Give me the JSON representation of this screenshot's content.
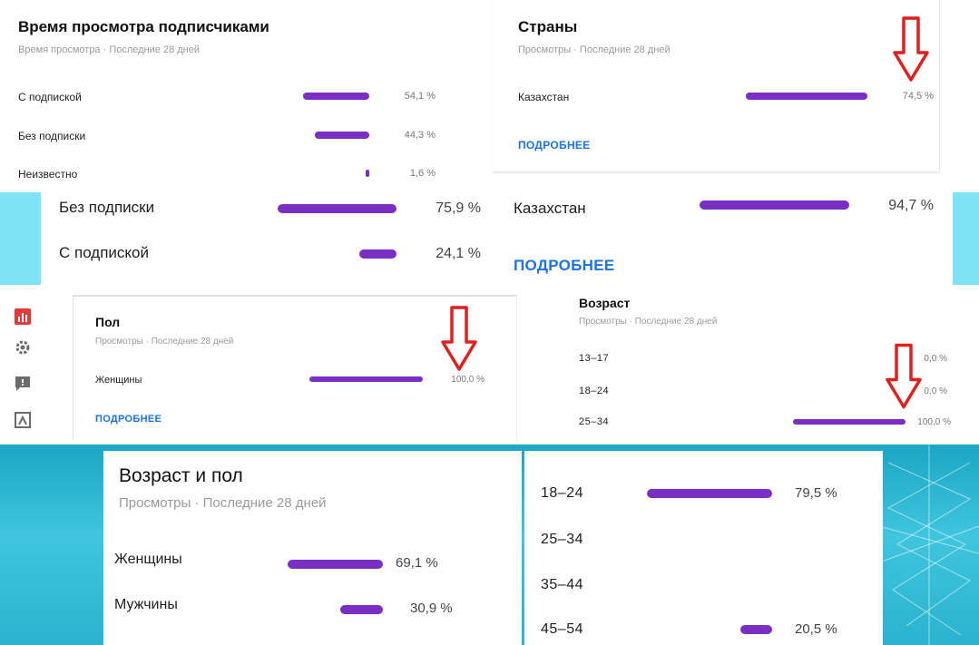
{
  "s1": {
    "title": "Время просмотра подписчиками",
    "subtitle": "Время просмотра · Последние 28 дней",
    "rows": [
      {
        "label": "С подпиской",
        "value": "54,1 %",
        "fraction": 0.541
      },
      {
        "label": "Без подписки",
        "value": "44,3 %",
        "fraction": 0.443
      },
      {
        "label": "Неизвестно",
        "value": "1,6 %",
        "fraction": 0.016
      }
    ]
  },
  "s2": {
    "title": "Страны",
    "subtitle": "Просмотры · Последние 28 дней",
    "rows": [
      {
        "label": "Казахстан",
        "value": "74,5 %",
        "fraction": 0.745
      }
    ],
    "more": "ПОДРОБНЕЕ"
  },
  "s3": {
    "rows": [
      {
        "label": "Без подписки",
        "value": "75,9 %",
        "fraction": 0.759
      },
      {
        "label": "С подпиской",
        "value": "24,1 %",
        "fraction": 0.241
      }
    ]
  },
  "s4": {
    "rows": [
      {
        "label": "Казахстан",
        "value": "94,7 %",
        "fraction": 0.947
      }
    ],
    "more": "ПОДРОБНЕЕ"
  },
  "s5": {
    "title": "Пол",
    "subtitle": "Просмотры · Последние 28 дней",
    "rows": [
      {
        "label": "Женщины",
        "value": "100,0 %",
        "fraction": 1.0
      }
    ],
    "more": "ПОДРОБНЕЕ"
  },
  "s6": {
    "title": "Возраст",
    "subtitle": "Просмотры · Последние 28 дней",
    "rows": [
      {
        "label": "13–17",
        "value": "0,0 %",
        "fraction": 0.0
      },
      {
        "label": "18–24",
        "value": "0,0 %",
        "fraction": 0.0
      },
      {
        "label": "25–34",
        "value": "100,0 %",
        "fraction": 1.0
      }
    ]
  },
  "s7": {
    "title": "Возраст и пол",
    "subtitle": "Просмотры · Последние 28 дней",
    "rows": [
      {
        "label": "Женщины",
        "value": "69,1 %",
        "fraction": 0.691
      },
      {
        "label": "Мужчины",
        "value": "30,9 %",
        "fraction": 0.309
      }
    ]
  },
  "s8": {
    "rows": [
      {
        "label": "18–24",
        "value": "79,5 %",
        "fraction": 0.795
      },
      {
        "label": "25–34",
        "value": "",
        "fraction": 0.0
      },
      {
        "label": "35–44",
        "value": "",
        "fraction": 0.0
      },
      {
        "label": "45–54",
        "value": "20,5 %",
        "fraction": 0.205
      }
    ]
  },
  "colors": {
    "bar": "#7b2ec4",
    "link": "#1a73e8",
    "arrow": "#e0201e",
    "cyan": "#7ee3f5",
    "studio_red": "#e53935"
  },
  "icons": [
    "analytics-icon",
    "settings-gear-icon",
    "feedback-icon",
    "audio-library-icon"
  ]
}
